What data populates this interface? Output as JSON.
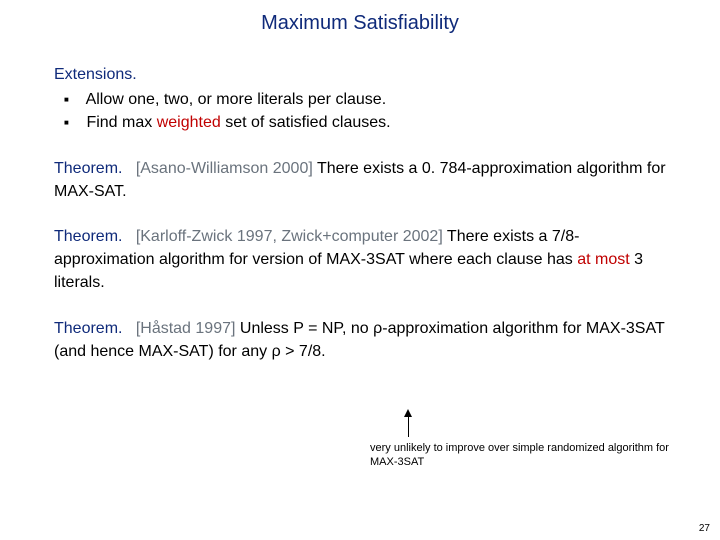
{
  "title": "Maximum Satisfiability",
  "extensions": {
    "label": "Extensions.",
    "items": [
      {
        "pre": "Allow one, two, or more literals per clause."
      },
      {
        "pre": "Find max ",
        "hl": "weighted",
        "post": " set of satisfied clauses."
      }
    ]
  },
  "thm1": {
    "label": "Theorem.",
    "cite": "[Asano-Williamson 2000]",
    "rest": "  There exists a 0. 784-approximation algorithm for MAX-SAT."
  },
  "thm2": {
    "label": "Theorem.",
    "cite": "[Karloff-Zwick 1997, Zwick+computer 2002]",
    "rest_a": "  There exists a 7/8-approximation algorithm for version of MAX-3SAT where each clause has ",
    "hl": "at most",
    "rest_b": " 3 literals."
  },
  "thm3": {
    "label": "Theorem.",
    "cite": "[Håstad 1997]",
    "rest_a": "  Unless P = NP, no ",
    "rho1": "ρ",
    "rest_b": "-approximation algorithm for MAX-3SAT (and hence MAX-SAT) for any ",
    "rho2": "ρ",
    "rest_c": " > 7/8."
  },
  "footnote": "very unlikely to improve over simple randomized algorithm for MAX-3SAT",
  "page": "27"
}
